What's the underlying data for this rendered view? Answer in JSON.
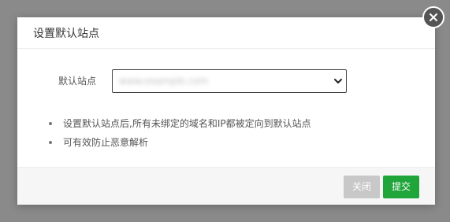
{
  "dialog": {
    "title": "设置默认站点"
  },
  "form": {
    "label": "默认站点",
    "select_value": "www.example.com"
  },
  "tips": [
    "设置默认站点后,所有未绑定的域名和IP都被定向到默认站点",
    "可有效防止恶意解析"
  ],
  "footer": {
    "close_label": "关闭",
    "submit_label": "提交"
  },
  "colors": {
    "submit": "#20a53a",
    "close_disabled": "#c8c8c8",
    "overlay": "#8a8a8a"
  },
  "icons": {
    "close": "close-icon",
    "select": "chevron-down-icon"
  }
}
